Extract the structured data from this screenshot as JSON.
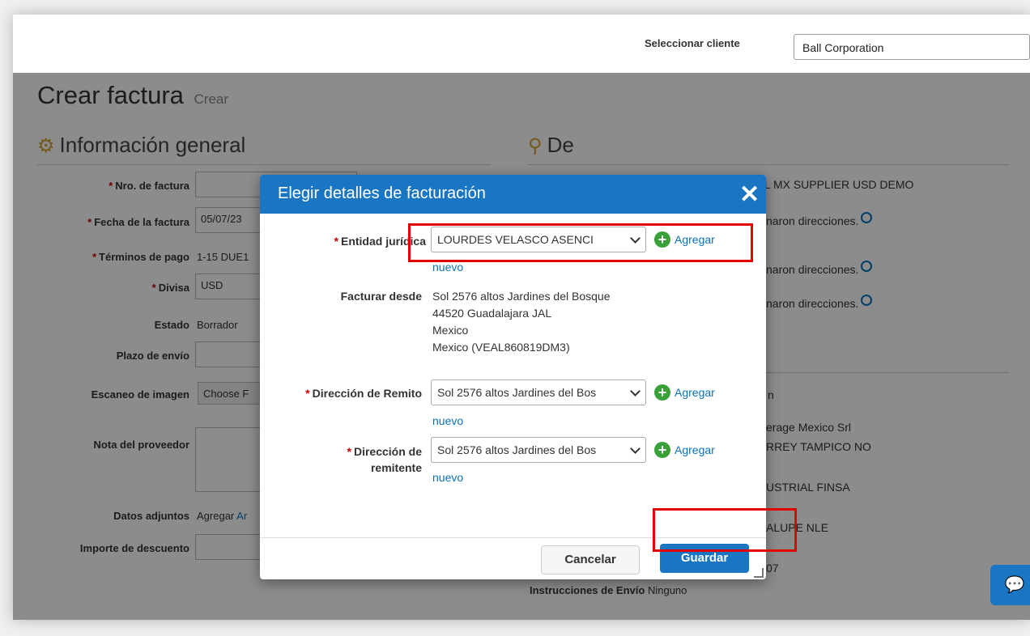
{
  "header": {
    "select_client_label": "Seleccionar cliente",
    "select_client_value": "Ball Corporation"
  },
  "page": {
    "title": "Crear factura",
    "title_sub": "Crear",
    "section_general": "Información general",
    "section_from": "De",
    "fields": {
      "invoice_no": "Nro. de factura",
      "invoice_date": "Fecha de la factura",
      "invoice_date_value": "05/07/23",
      "payment_terms": "Términos de pago",
      "payment_terms_value": "1-15 DUE1",
      "currency": "Divisa",
      "currency_value": "USD",
      "status": "Estado",
      "status_value": "Borrador",
      "ship_term": "Plazo de envío",
      "image_scan": "Escaneo de imagen",
      "choose_file": "Choose F",
      "supplier_note": "Nota del proveedor",
      "attachments": "Datos adjuntos",
      "attachments_add": "Agregar",
      "attachments_link": "Ar",
      "discount": "Importe de descuento"
    },
    "right": {
      "supplier": "LL MX SUPPLIER USD DEMO",
      "no_address_1": "naron direcciones.",
      "no_address_2": "naron direcciones.",
      "no_address_3": "naron direcciones.",
      "to_frag": "n",
      "cust_1": "erage Mexico Srl",
      "cust_2": "RREY TAMPICO NO",
      "cust_3": "USTRIAL FINSA",
      "cust_4": "ALUPE NLE",
      "cust_5": "07",
      "ship_instr_label": "Instrucciones de Envío",
      "ship_instr_value": "Ninguno"
    }
  },
  "modal": {
    "title": "Elegir detalles de facturación",
    "close": "✕",
    "legal_entity_label": "Entidad jurídica",
    "legal_entity_value": "LOURDES VELASCO ASENCI",
    "add": "Agregar",
    "new": "nuevo",
    "bill_from_label": "Facturar desde",
    "bill_from_lines": [
      "Sol 2576 altos Jardines del Bosque",
      "44520 Guadalajara JAL",
      "Mexico",
      "Mexico (VEAL860819DM3)"
    ],
    "remit_label": "Dirección de Remito",
    "remit_value": "Sol 2576 altos Jardines del Bos",
    "sender_label_1": "Dirección de",
    "sender_label_2": "remitente",
    "sender_value": "Sol 2576 altos Jardines del Bos",
    "cancel": "Cancelar",
    "save": "Guardar"
  },
  "colors": {
    "accent": "#1a76c2",
    "required": "#cc0000",
    "link": "#0a71b9",
    "add_icon": "#3aa03a",
    "highlight": "#e00000"
  }
}
